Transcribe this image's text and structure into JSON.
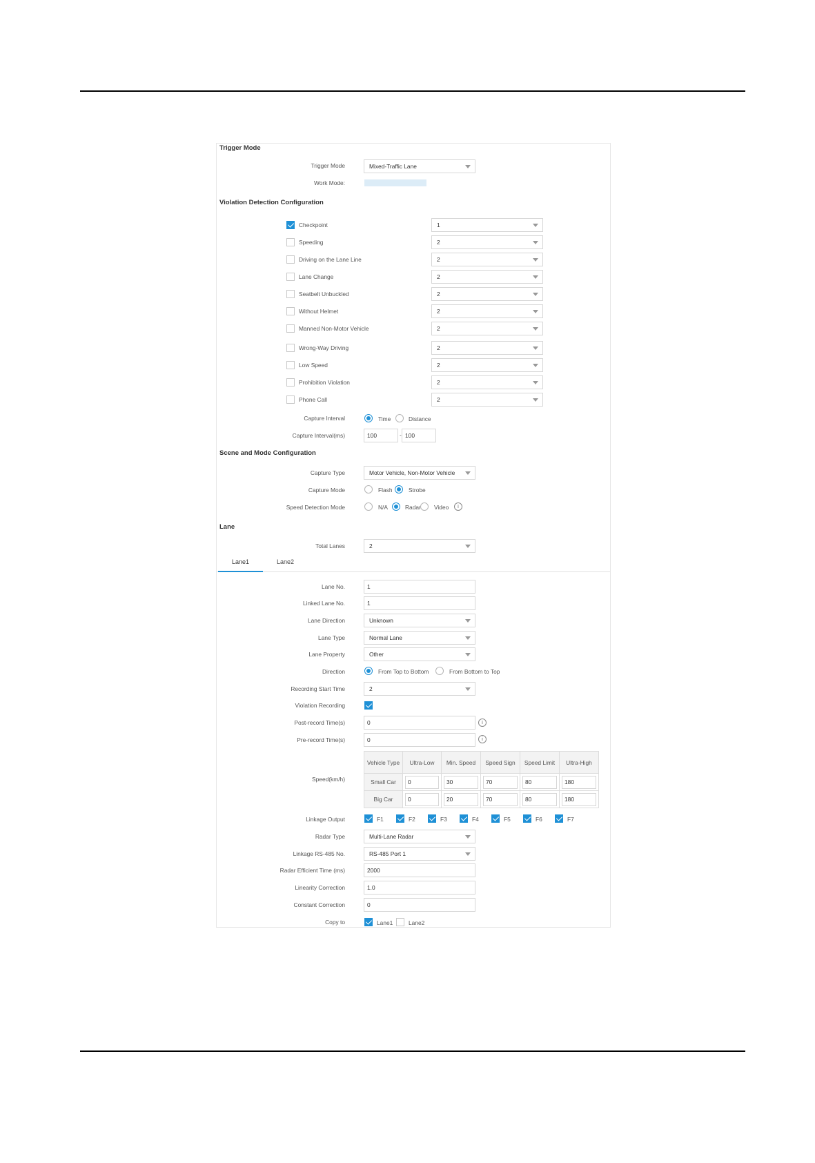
{
  "trigger_mode_section": {
    "title": "Trigger Mode",
    "trigger_mode_label": "Trigger Mode",
    "trigger_mode_value": "Mixed-Traffic Lane",
    "work_mode_label": "Work Mode:"
  },
  "violation_section": {
    "title": "Violation Detection Configuration",
    "items": [
      {
        "label": "Checkpoint",
        "checked": true,
        "value": "1"
      },
      {
        "label": "Speeding",
        "checked": false,
        "value": "2"
      },
      {
        "label": "Driving on the Lane Line",
        "checked": false,
        "value": "2"
      },
      {
        "label": "Lane Change",
        "checked": false,
        "value": "2"
      },
      {
        "label": "Seatbelt Unbuckled",
        "checked": false,
        "value": "2"
      },
      {
        "label": "Without Helmet",
        "checked": false,
        "value": "2"
      },
      {
        "label": "Manned Non-Motor Vehicle",
        "checked": false,
        "value": "2"
      },
      {
        "label": "Wrong-Way Driving",
        "checked": false,
        "value": "2"
      },
      {
        "label": "Low Speed",
        "checked": false,
        "value": "2"
      },
      {
        "label": "Prohibition Violation",
        "checked": false,
        "value": "2"
      },
      {
        "label": "Phone Call",
        "checked": false,
        "value": "2"
      }
    ],
    "capture_interval_label": "Capture Interval",
    "capture_interval_options": [
      "Time",
      "Distance"
    ],
    "capture_interval_selected": "Time",
    "capture_interval_ms_label": "Capture Interval(ms)",
    "capture_interval_ms_1": "100",
    "capture_interval_ms_2": "100",
    "interval_separator": "-"
  },
  "scene_section": {
    "title": "Scene and Mode Configuration",
    "capture_type_label": "Capture Type",
    "capture_type_value": "Motor Vehicle, Non-Motor Vehicle",
    "capture_mode_label": "Capture Mode",
    "capture_mode_options": [
      "Flash",
      "Strobe"
    ],
    "capture_mode_selected": "Strobe",
    "speed_detection_label": "Speed Detection Mode",
    "speed_detection_options": [
      "N/A",
      "Radar",
      "Video"
    ],
    "speed_detection_selected": "Radar"
  },
  "lane_section": {
    "title": "Lane",
    "total_lanes_label": "Total Lanes",
    "total_lanes_value": "2",
    "tabs": [
      "Lane1",
      "Lane2"
    ],
    "active_tab": "Lane1"
  },
  "lane_form": {
    "lane_no_label": "Lane No.",
    "lane_no_value": "1",
    "linked_lane_no_label": "Linked Lane No.",
    "linked_lane_no_value": "1",
    "lane_direction_label": "Lane Direction",
    "lane_direction_value": "Unknown",
    "lane_type_label": "Lane Type",
    "lane_type_value": "Normal Lane",
    "lane_property_label": "Lane Property",
    "lane_property_value": "Other",
    "direction_label": "Direction",
    "direction_options": [
      "From Top to Bottom",
      "From Bottom to Top"
    ],
    "direction_selected": "From Top to Bottom",
    "recording_start_label": "Recording Start Time",
    "recording_start_value": "2",
    "violation_recording_label": "Violation Recording",
    "violation_recording_checked": true,
    "post_record_label": "Post-record Time(s)",
    "post_record_value": "0",
    "pre_record_label": "Pre-record Time(s)",
    "pre_record_value": "0",
    "info_glyph": "i",
    "speed_label": "Speed(km/h)",
    "speed_table": {
      "headers": [
        "Vehicle Type",
        "Ultra-Low",
        "Min. Speed",
        "Speed Sign",
        "Speed Limit",
        "Ultra-High"
      ],
      "rows": [
        {
          "type": "Small Car",
          "values": [
            "0",
            "30",
            "70",
            "80",
            "180"
          ]
        },
        {
          "type": "Big Car",
          "values": [
            "0",
            "20",
            "70",
            "80",
            "180"
          ]
        }
      ]
    },
    "linkage_output_label": "Linkage Output",
    "linkage_outputs": [
      {
        "label": "F1",
        "checked": true
      },
      {
        "label": "F2",
        "checked": true
      },
      {
        "label": "F3",
        "checked": true
      },
      {
        "label": "F4",
        "checked": true
      },
      {
        "label": "F5",
        "checked": true
      },
      {
        "label": "F6",
        "checked": true
      },
      {
        "label": "F7",
        "checked": true
      }
    ],
    "radar_type_label": "Radar Type",
    "radar_type_value": "Multi-Lane Radar",
    "linkage_rs485_label": "Linkage RS-485 No.",
    "linkage_rs485_value": "RS-485 Port 1",
    "radar_efficient_label": "Radar Efficient Time (ms)",
    "radar_efficient_value": "2000",
    "linearity_label": "Linearity Correction",
    "linearity_value": "1.0",
    "constant_label": "Constant Correction",
    "constant_value": "0",
    "copy_to_label": "Copy to",
    "copy_to": [
      {
        "label": "Lane1",
        "checked": true
      },
      {
        "label": "Lane2",
        "checked": false
      }
    ]
  },
  "colors": {
    "accent": "#1e90d6",
    "border": "#d6d6d6",
    "rule": "#000000"
  }
}
